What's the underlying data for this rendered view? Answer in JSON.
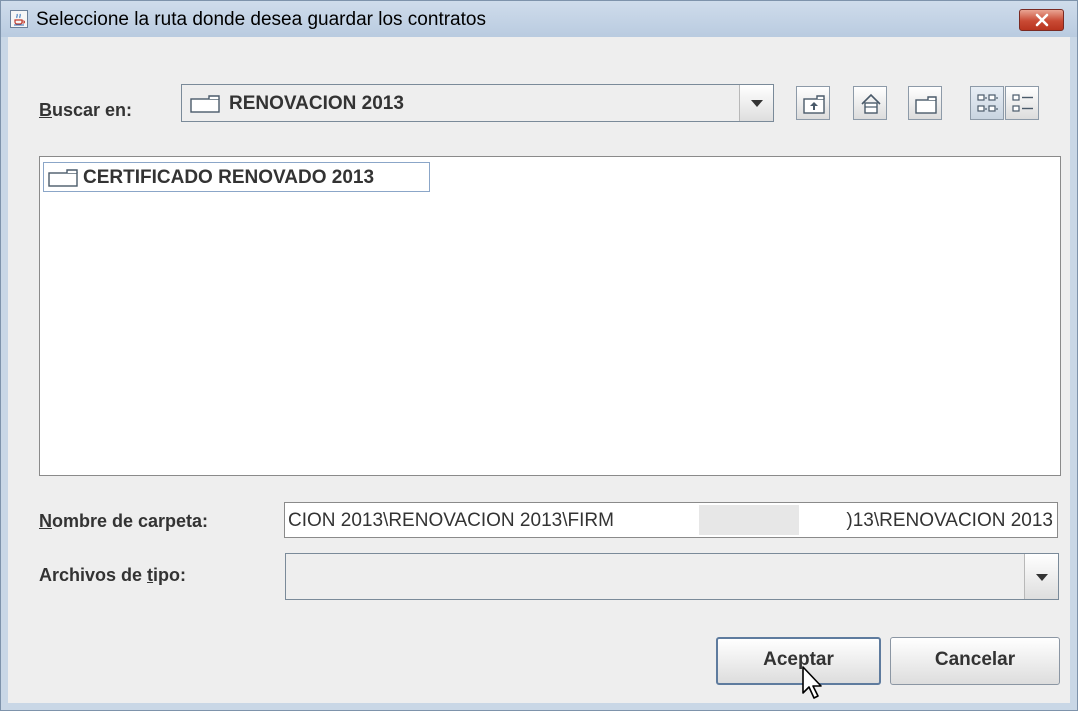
{
  "dialog": {
    "title": "Seleccione la ruta donde desea guardar los contratos",
    "icons": {
      "app": "java-cup-icon",
      "close": "close-icon"
    }
  },
  "look_in": {
    "label_mnemonic": "B",
    "label_rest": "uscar en:",
    "selected_value": "RENOVACION 2013",
    "icon": "folder-icon"
  },
  "toolbar": {
    "buttons": [
      {
        "name": "up-one-level",
        "icon": "folder-up-icon"
      },
      {
        "name": "home",
        "icon": "home-icon"
      },
      {
        "name": "new-folder",
        "icon": "new-folder-icon"
      },
      {
        "name": "list-view",
        "icon": "list-view-icon"
      },
      {
        "name": "details-view",
        "icon": "details-view-icon"
      }
    ]
  },
  "files": [
    {
      "name": "CERTIFICADO RENOVADO 2013",
      "icon": "folder-icon",
      "selected": true
    }
  ],
  "folder_name": {
    "label_mnemonic": "N",
    "label_rest": "ombre de carpeta:",
    "value_left": "CION 2013\\RENOVACION 2013\\FIRM",
    "value_right": ")13\\RENOVACION 2013"
  },
  "file_type": {
    "label_before": "Archivos de ",
    "label_mnemonic": "t",
    "label_after": "ipo:",
    "selected_value": ""
  },
  "buttons": {
    "accept": "Aceptar",
    "cancel": "Cancelar"
  },
  "colors": {
    "title_bar": "#c9d7e6",
    "close_button": "#c94a34",
    "panel_background": "#eeeeee",
    "selection_border": "#8ba6c8"
  }
}
